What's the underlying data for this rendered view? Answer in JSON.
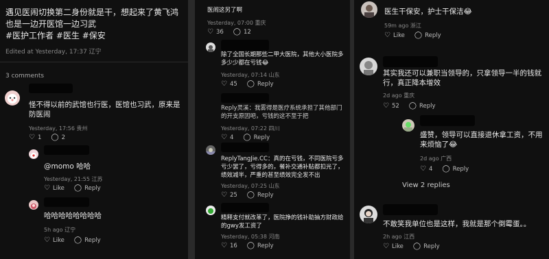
{
  "panel1": {
    "post_text": "遇见医闹切换第二身份就是干，想起来了黄飞鸿也是一边开医馆一边习武",
    "hashtags": "#医护工作者 #医生 #保安",
    "edited": "Edited at Yesterday, 17:37 辽宁",
    "comments_count": "3 comments",
    "c1": {
      "text": "怪不得以前的武馆也行医，医馆也习武，原来是防医闹",
      "meta": "Yesterday, 17:56 贵州",
      "likes": "1",
      "replies": "2"
    },
    "c2": {
      "text": "@momo 哈哈",
      "meta": "Yesterday, 21:55 江苏",
      "like": "Like",
      "reply": "Reply"
    },
    "c3": {
      "text": "哈哈哈哈哈哈哈哈",
      "meta": "5h ago 辽宁",
      "like": "Like",
      "reply": "Reply"
    }
  },
  "panel2": {
    "top_text": "医闹这另了啊",
    "top_meta": "Yesterday, 07:00 重庆",
    "top_likes": "36",
    "top_replies": "12",
    "c1": {
      "text": "除了全国长期那些二甲大医院，其他大小医院多多少少都在亏钱😂",
      "meta": "Yesterday, 07:14 山东",
      "likes": "45",
      "reply": "Reply"
    },
    "c2": {
      "text": "Reply灵溪：我雾得是医疗系统承担了其他部门的开支原因吧，亏钱的这不至于把",
      "meta": "Yesterday, 07:22 四川",
      "likes": "4",
      "reply": "Reply"
    },
    "c3": {
      "text": "ReplyTangJie.CC：真的在亏钱，不同医院亏多亏少罢了，亏得多的，餐补交通补贴都扣光了，绩效减半，严重的甚至绩效完全发不出",
      "meta": "Yesterday, 07:25 山东",
      "likes": "25",
      "reply": "Reply"
    },
    "c4": {
      "text": "精释支付就改革了，医院挣的钱补助抽方财政给的gwy发工资了",
      "meta": "Yesterday, 05:38 河南",
      "likes": "16",
      "reply": "Reply"
    }
  },
  "panel3": {
    "c1": {
      "text": "医生干保安，护士干保洁😂",
      "meta": "59m ago 浙江",
      "like": "Like",
      "reply": "Reply"
    },
    "c2": {
      "text": "其实我还可以兼职当领导的，只拿领导一半的钱就行，真正降本增效",
      "meta": "2d ago 重庆",
      "likes": "52",
      "reply": "Reply"
    },
    "c3": {
      "text": "盛赞，领导可以直接退休拿工资，不用来烦恼了😂",
      "meta": "2d ago 广西",
      "likes": "4",
      "reply": "Reply"
    },
    "view_replies": "View 2 replies",
    "c4": {
      "text": "不敢笑我单位也是这样，我就是那个倒霉蛋。。",
      "meta": "2h ago 江西",
      "like": "Like",
      "reply": "Reply"
    }
  },
  "colors": {
    "bg": "#101010",
    "text": "#e9e9e9",
    "meta": "#8a8a8a",
    "redact": "#050505"
  },
  "icons": [
    "heart-icon",
    "comment-icon",
    "repost-icon",
    "share-icon"
  ]
}
